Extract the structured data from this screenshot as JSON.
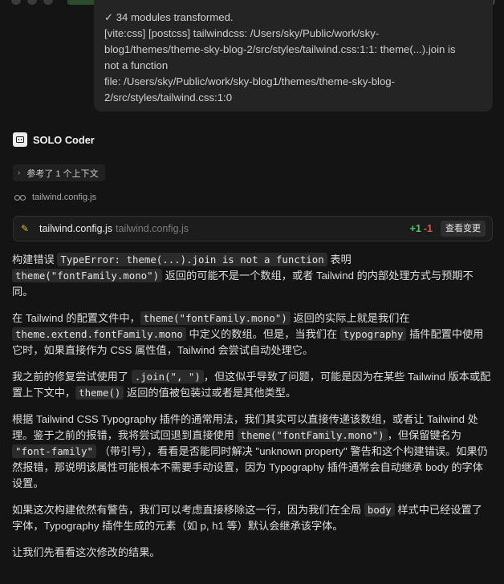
{
  "log": {
    "lines": [
      "✓ 34 modules transformed.",
      "[vite:css] [postcss] tailwindcss: /Users/sky/Public/work/sky-",
      "blog1/themes/theme-sky-blog-2/src/styles/tailwind.css:1:1: theme(...).join is",
      "not a function",
      "file: /Users/sky/Public/work/sky-blog1/themes/theme-sky-blog-",
      "2/src/styles/tailwind.css:1:0"
    ]
  },
  "agent": {
    "name": "SOLO Coder"
  },
  "context_chip": {
    "label": "参考了 1 个上下文"
  },
  "file_ref": {
    "name": "tailwind.config.js"
  },
  "diff": {
    "file_name": "tailwind.config.js",
    "file_path": "tailwind.config.js",
    "additions": "+1",
    "deletions": "-1",
    "view_label": "查看变更"
  },
  "paragraphs": {
    "p1": {
      "a": "构建错误 ",
      "c1": "TypeError: theme(...).join is not a function",
      "b": " 表明 ",
      "c2": "theme(\"fontFamily.mono\")",
      "d": " 返回的可能不是一个数组，或者 Tailwind 的内部处理方式与预期不同。"
    },
    "p2": {
      "a": "在 Tailwind 的配置文件中，",
      "c1": "theme(\"fontFamily.mono\")",
      "b": " 返回的实际上就是我们在 ",
      "c2": "theme.extend.fontFamily.mono",
      "d": " 中定义的数组。但是，当我们在 ",
      "c3": "typography",
      "e": " 插件配置中使用它时，如果直接作为 CSS 属性值，Tailwind 会尝试自动处理它。"
    },
    "p3": {
      "a": "我之前的修复尝试使用了 ",
      "c1": ".join(\", \")",
      "b": "，但这似乎导致了问题，可能是因为在某些 Tailwind 版本或配置上下文中，",
      "c2": "theme()",
      "d": " 返回的值被包装过或者是其他类型。"
    },
    "p4": {
      "a": "根据 Tailwind CSS Typography 插件的通常用法，我们其实可以直接传递该数组，或者让 Tailwind 处理。鉴于之前的报错，我将尝试回退到直接使用 ",
      "c1": "theme(\"fontFamily.mono\")",
      "b": "，但保留键名为 ",
      "c2": "\"font-family\"",
      "d": " （带引号），看看是否能同时解决 \"unknown property\" 警告和这个构建错误。如果仍然报错，那说明该属性可能根本不需要手动设置，因为 Typography 插件通常会自动继承 body 的字体设置。"
    },
    "p5": {
      "a": "如果这次构建依然有警告，我们可以考虑直接移除这一行，因为我们在全局 ",
      "c1": "body",
      "b": " 样式中已经设置了字体，Typography 插件生成的元素（如 p, h1 等）默认会继承该字体。"
    },
    "p6": {
      "a": "让我们先看看这次修改的结果。"
    }
  }
}
